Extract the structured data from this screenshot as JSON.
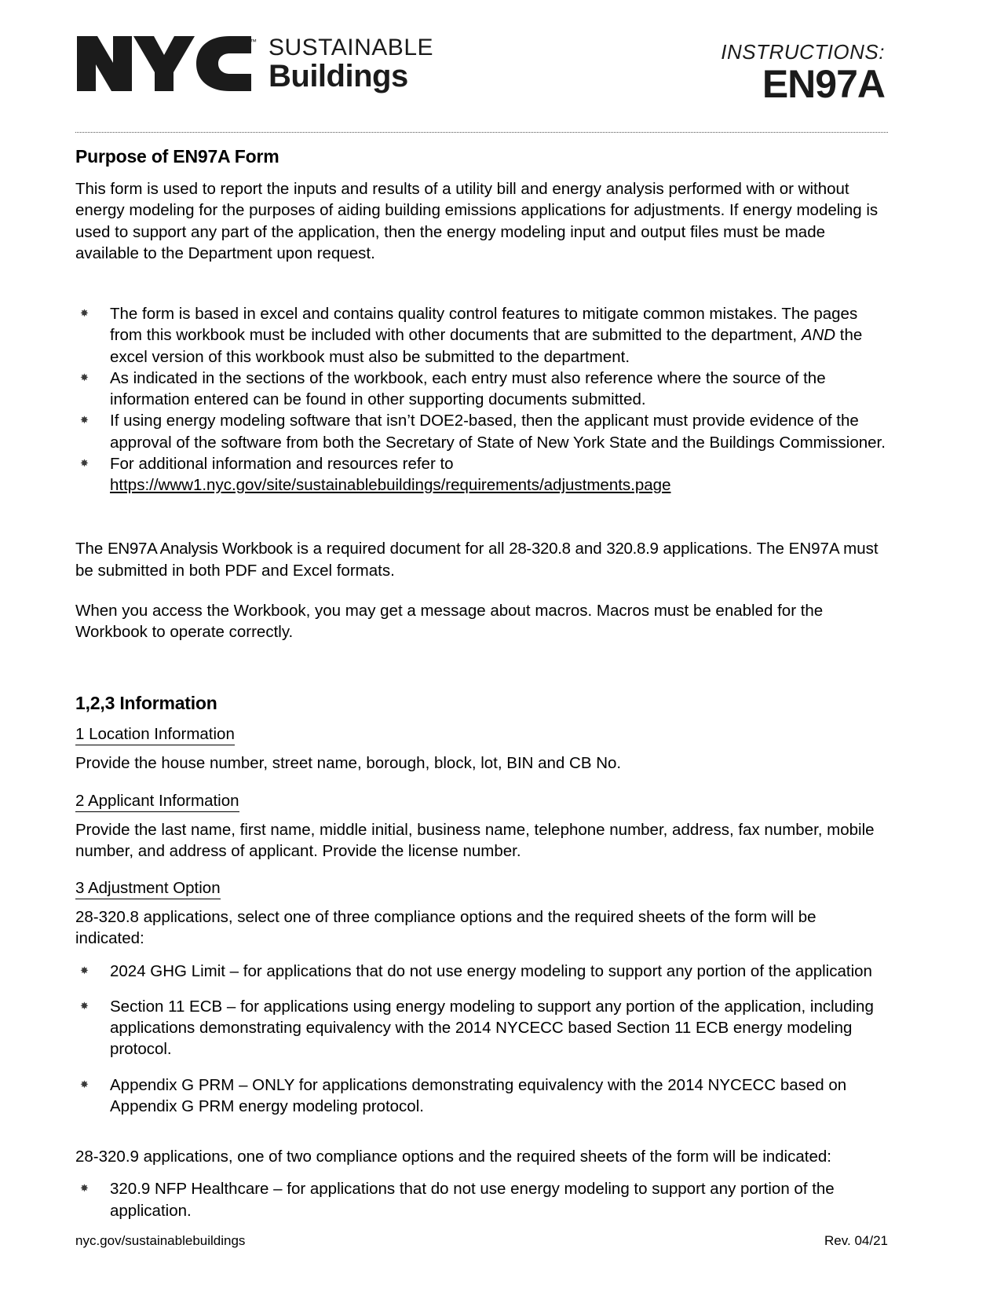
{
  "header": {
    "logo_alt": "NYC",
    "brand_line1": "SUSTAINABLE",
    "brand_line2": "Buildings",
    "instructions_label": "INSTRUCTIONS:",
    "form_code": "EN97A"
  },
  "purpose": {
    "title": "Purpose of EN97A Form",
    "intro": "This form is used to report the inputs and results of a utility bill and energy analysis performed with or without energy modeling for the purposes of aiding building emissions applications for adjustments. If energy modeling is used to support any part of the application, then the energy modeling input and output files must be made available to the Department upon request.",
    "bullets": [
      {
        "pre": "The form is based in excel and contains quality control features to mitigate common mistakes. The pages from this workbook must be included with other documents that are submitted to the department, ",
        "italic": "AND",
        "post": " the excel version of this workbook must also be submitted to the department."
      },
      {
        "pre": "As indicated in the sections of the workbook, each entry must also reference where the source of the information entered can be found in other supporting documents submitted.",
        "italic": "",
        "post": ""
      },
      {
        "pre": "If using energy modeling software that isn’t DOE2-based, then the applicant must provide evidence of the approval of the software from both the Secretary of State of New York State and the Buildings Commissioner.",
        "italic": "",
        "post": ""
      }
    ],
    "link_bullet": {
      "text": "For additional information and resources refer to",
      "url_text": "https://www1.nyc.gov/site/sustainablebuildings/requirements/adjustments.page"
    },
    "workbook_para": {
      "p1": "The ",
      "emph1": "EN97A Analysis Workbook",
      "p2": " is a required document for all ",
      "emph2": "28-320.8",
      "p3": " and ",
      "emph3": "320.8.9",
      "p4": " applications. The EN97A must be submitted in both PDF and Excel formats."
    },
    "macros_para": "When you access the Workbook, you may get a message about macros. Macros must be enabled for the Workbook to operate correctly."
  },
  "information": {
    "title": "1,2,3 Information",
    "subsections": [
      {
        "heading": "1 Location Information",
        "body": "Provide the house number, street name, borough, block, lot, BIN and CB No."
      },
      {
        "heading": "2 Applicant Information",
        "body": "Provide the last name, first name, middle initial, business name, telephone number, address, fax number, mobile number, and address of applicant. Provide the license number."
      }
    ],
    "adjustment": {
      "heading": "3 Adjustment Option",
      "intro_8": "28-320.8 applications, select one of three compliance options and the required sheets of the form will be indicated:",
      "options_8": [
        "2024 GHG Limit – for applications that do not use energy modeling to support any portion of the application",
        "Section 11 ECB – for applications using energy modeling to support any portion of the application, including applications demonstrating equivalency with the 2014 NYCECC based Section 11 ECB energy modeling protocol.",
        "Appendix G PRM – ONLY for applications demonstrating equivalency with the 2014 NYCECC based on Appendix G PRM energy modeling protocol."
      ],
      "intro_9": "28-320.9 applications, one of two compliance options and the required sheets of the form will be indicated:",
      "options_9": [
        "320.9 NFP Healthcare – for applications that do not use energy modeling to support any portion of the application."
      ]
    }
  },
  "footer": {
    "left": "nyc.gov/sustainablebuildings",
    "right": "Rev. 04/21"
  },
  "icons": {
    "bullet": "✸"
  }
}
